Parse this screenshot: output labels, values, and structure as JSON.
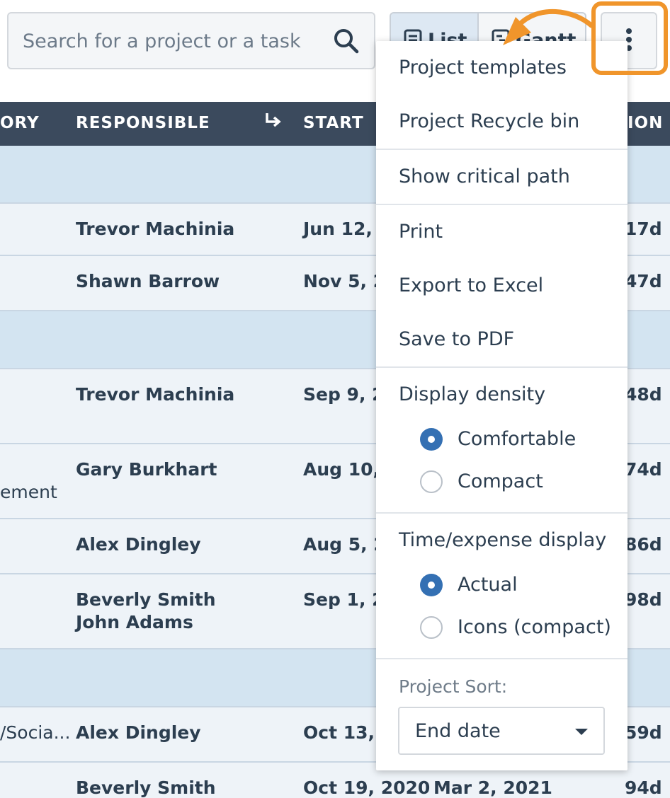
{
  "search": {
    "placeholder": "Search for a project or a task"
  },
  "view_toggle": {
    "list_label": "List",
    "gantt_label": "Gantt",
    "active": "List"
  },
  "table": {
    "columns": [
      "ORY",
      "RESPONSIBLE",
      "START",
      "ION"
    ],
    "rows": [
      {
        "type": "group"
      },
      {
        "category": "",
        "responsible": [
          "Trevor Machinia"
        ],
        "start": "Jun 12, 2",
        "duration": "17d"
      },
      {
        "category": "",
        "responsible": [
          "Shawn Barrow"
        ],
        "start": "Nov 5, 20",
        "duration": "47d"
      },
      {
        "type": "group"
      },
      {
        "category": "",
        "responsible": [
          "Trevor Machinia"
        ],
        "start": "Sep 9, 20",
        "duration": "48d"
      },
      {
        "category": "ement",
        "responsible": [
          "Gary Burkhart"
        ],
        "start": "Aug 10, 2",
        "duration": "74d"
      },
      {
        "category": "",
        "responsible": [
          "Alex Dingley"
        ],
        "start": "Aug 5, 20",
        "duration": "86d"
      },
      {
        "category": "",
        "responsible": [
          "Beverly Smith",
          "John Adams"
        ],
        "start": "Sep 1, 20",
        "duration": "98d"
      },
      {
        "type": "group"
      },
      {
        "category": "/Socia...",
        "responsible": [
          "Alex Dingley"
        ],
        "start": "Oct 13, 2",
        "duration": "59d"
      },
      {
        "category": "",
        "responsible": [
          "Beverly Smith"
        ],
        "start": "Oct 19, 2020",
        "end": "Mar 2, 2021",
        "duration": "94d"
      }
    ]
  },
  "menu": {
    "project_templates": "Project templates",
    "recycle_bin": "Project Recycle bin",
    "critical_path": "Show critical path",
    "print": "Print",
    "export_excel": "Export to Excel",
    "save_pdf": "Save to PDF",
    "density": {
      "heading": "Display density",
      "options": [
        "Comfortable",
        "Compact"
      ],
      "selected": "Comfortable"
    },
    "time_expense": {
      "heading": "Time/expense display",
      "options": [
        "Actual",
        "Icons (compact)"
      ],
      "selected": "Actual"
    },
    "sort": {
      "label": "Project Sort:",
      "value": "End date"
    }
  },
  "colors": {
    "header_bg": "#3b4a5d",
    "group_row_bg": "#d3e4f1",
    "row_bg": "#eef3f8",
    "radio_checked": "#3470b3",
    "highlight": "#f0952b"
  },
  "icons": {
    "search": "search-icon",
    "more": "more-vertical-icon",
    "list": "list-icon",
    "gantt": "gantt-icon",
    "indent": "indent-arrow-icon"
  }
}
